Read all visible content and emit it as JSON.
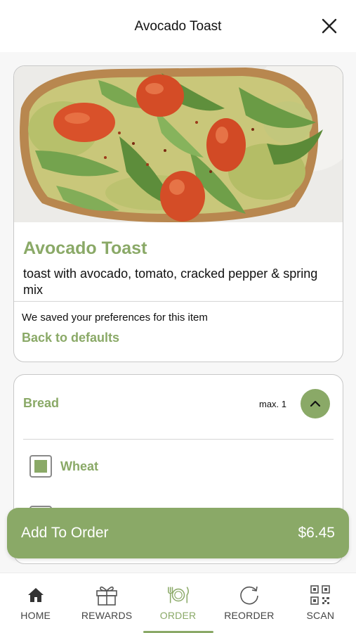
{
  "header": {
    "title": "Avocado Toast"
  },
  "item": {
    "name": "Avocado Toast",
    "description": "toast with avocado, tomato, cracked pepper & spring mix",
    "preferences_notice": "We saved your preferences for this item",
    "back_to_defaults": "Back to defaults"
  },
  "options": {
    "group_title": "Bread",
    "group_max": "max. 1",
    "items": [
      {
        "label": "Wheat",
        "checked": true
      },
      {
        "label": "",
        "checked": false
      }
    ]
  },
  "add_to_order": {
    "label": "Add To Order",
    "price": "$6.45"
  },
  "nav": {
    "items": [
      {
        "label": "HOME",
        "icon": "home-icon"
      },
      {
        "label": "REWARDS",
        "icon": "gift-icon"
      },
      {
        "label": "ORDER",
        "icon": "plate-utensils-icon",
        "active": true
      },
      {
        "label": "REORDER",
        "icon": "reorder-icon"
      },
      {
        "label": "SCAN",
        "icon": "qr-code-icon"
      }
    ]
  },
  "colors": {
    "accent": "#8aa967",
    "text": "#111111",
    "border": "#c8c8c8"
  }
}
